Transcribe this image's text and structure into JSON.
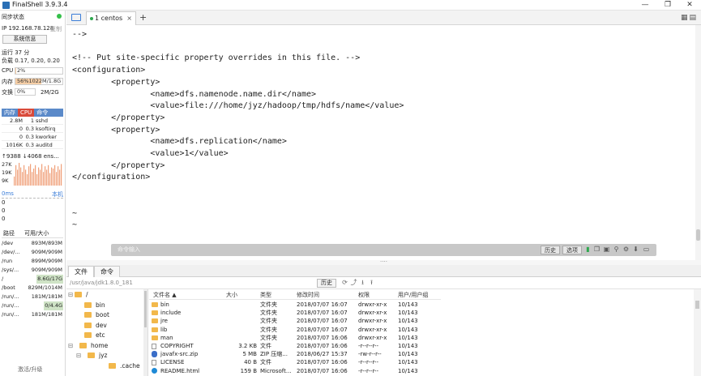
{
  "window": {
    "title": "FinalShell 3.9.3.4",
    "minimize": "—",
    "restore": "❐",
    "close": "✕"
  },
  "sidebar": {
    "sync_status": "同步状态",
    "sync_indicator_color": "#35c04a",
    "ip": "IP 192.168.78.128",
    "copy": "复制",
    "sys_info_button": "系统信息",
    "uptime": "运行 37 分",
    "load": "负载 0.17, 0.20, 0.20",
    "cpu_label": "CPU",
    "cpu_value": "2%",
    "cpu_percent": 2,
    "mem_label": "内存",
    "mem_value": "56%1022M/1.8G",
    "mem_percent": 56,
    "swap_label": "交换",
    "swap_value": "0%",
    "swap_total": "2M/2G",
    "proc_tabs": [
      "内存",
      "CPU",
      "命令"
    ],
    "processes": [
      {
        "mem": "2.8M",
        "cpu": "1",
        "cmd": "sshd"
      },
      {
        "mem": "0",
        "cpu": "0.3",
        "cmd": "ksoftirq"
      },
      {
        "mem": "0",
        "cpu": "0.3",
        "cmd": "kworker"
      },
      {
        "mem": "1016K",
        "cpu": "0.3",
        "cmd": "auditd"
      }
    ],
    "net_summary": "↑9388 ↓4068 ens...",
    "net_axis": [
      "27K",
      "19K",
      "9K"
    ],
    "latency_label": "0ms",
    "latency_host": "本机",
    "latency_values": [
      "0",
      "0",
      "0"
    ],
    "disk_header": {
      "path": "路径",
      "size": "可用/大小"
    },
    "disks": [
      {
        "path": "/dev",
        "size": "893M/893M",
        "highlight": false
      },
      {
        "path": "/dev/...",
        "size": "909M/909M",
        "highlight": false
      },
      {
        "path": "/run",
        "size": "899M/909M",
        "highlight": false
      },
      {
        "path": "/sys/...",
        "size": "909M/909M",
        "highlight": false
      },
      {
        "path": "/",
        "size": "8.6G/17G",
        "highlight": true
      },
      {
        "path": "/boot",
        "size": "829M/1014M",
        "highlight": false
      },
      {
        "path": "/run/...",
        "size": "181M/181M",
        "highlight": false
      },
      {
        "path": "/run/...",
        "size": "0/4.4G",
        "highlight": true
      },
      {
        "path": "/run/...",
        "size": "181M/181M",
        "highlight": false
      }
    ],
    "activate": "激活/升级"
  },
  "tabs": {
    "items": [
      {
        "label": "1 centos",
        "close": "×"
      }
    ],
    "add": "+"
  },
  "terminal": {
    "lines": [
      "-->",
      "",
      "<!-- Put site-specific property overrides in this file. -->",
      "<configuration>",
      "        <property>",
      "                <name>dfs.namenode.name.dir</name>",
      "                <value>file:///home/jyz/hadoop/tmp/hdfs/name</value>",
      "        </property>",
      "        <property>",
      "                <name>dfs.replication</name>",
      "                <value>1</value>",
      "        </property>",
      "</configuration>",
      "",
      "",
      "~",
      "~"
    ]
  },
  "command_bar": {
    "placeholder": "命令输入",
    "history": "历史",
    "options": "选项"
  },
  "bottom_tabs": [
    "文件",
    "命令"
  ],
  "file_browser": {
    "path": "/usr/java/jdk1.8.0_181",
    "history_button": "历史",
    "tree": [
      {
        "label": "/",
        "expander": "⊟"
      },
      {
        "label": "bin",
        "expander": ""
      },
      {
        "label": "boot",
        "expander": ""
      },
      {
        "label": "dev",
        "expander": ""
      },
      {
        "label": "etc",
        "expander": ""
      },
      {
        "label": "home",
        "expander": "⊟"
      },
      {
        "label": "jyz",
        "expander": "⊟"
      },
      {
        "label": ".cache",
        "expander": ""
      }
    ],
    "columns": {
      "name": "文件名 ▲",
      "size": "大小",
      "type": "类型",
      "modified": "修改时间",
      "perm": "权限",
      "owner": "用户/用户组"
    },
    "files": [
      {
        "name": "bin",
        "size": "",
        "type": "文件夹",
        "modified": "2018/07/07 16:07",
        "perm": "drwxr-xr-x",
        "owner": "10/143",
        "icon": "dir"
      },
      {
        "name": "include",
        "size": "",
        "type": "文件夹",
        "modified": "2018/07/07 16:07",
        "perm": "drwxr-xr-x",
        "owner": "10/143",
        "icon": "dir"
      },
      {
        "name": "jre",
        "size": "",
        "type": "文件夹",
        "modified": "2018/07/07 16:07",
        "perm": "drwxr-xr-x",
        "owner": "10/143",
        "icon": "dir"
      },
      {
        "name": "lib",
        "size": "",
        "type": "文件夹",
        "modified": "2018/07/07 16:07",
        "perm": "drwxr-xr-x",
        "owner": "10/143",
        "icon": "dir"
      },
      {
        "name": "man",
        "size": "",
        "type": "文件夹",
        "modified": "2018/07/07 16:06",
        "perm": "drwxr-xr-x",
        "owner": "10/143",
        "icon": "dir"
      },
      {
        "name": "COPYRIGHT",
        "size": "3.2 KB",
        "type": "文件",
        "modified": "2018/07/07 16:06",
        "perm": "-r--r--r--",
        "owner": "10/143",
        "icon": "file"
      },
      {
        "name": "javafx-src.zip",
        "size": "5 MB",
        "type": "ZIP 压缩...",
        "modified": "2018/06/27 15:37",
        "perm": "-rw-r--r--",
        "owner": "10/143",
        "icon": "zip"
      },
      {
        "name": "LICENSE",
        "size": "40 B",
        "type": "文件",
        "modified": "2018/07/07 16:06",
        "perm": "-r--r--r--",
        "owner": "10/143",
        "icon": "file"
      },
      {
        "name": "README.html",
        "size": "159 B",
        "type": "Microsoft...",
        "modified": "2018/07/07 16:06",
        "perm": "-r--r--r--",
        "owner": "10/143",
        "icon": "web"
      }
    ]
  },
  "colors": {
    "accent": "#3b7dd8",
    "cpu_tab": "#d94a3a",
    "proc_tab_bar": "#5b8ac9",
    "mem_fill": "#f6cfa7",
    "net_up": "#d94a3a",
    "net_down": "#2a8f3a",
    "folder": "#f2b84b"
  },
  "net_chart": {
    "heights": [
      0.4,
      0.9,
      0.7,
      1.0,
      0.8,
      0.6,
      0.9,
      0.7,
      0.5,
      0.85,
      0.95,
      0.6,
      0.75,
      0.9,
      0.5,
      0.8,
      0.7,
      0.95,
      0.6,
      0.85,
      0.7,
      0.9,
      0.55,
      0.8,
      0.75,
      0.9,
      0.6,
      0.85,
      0.7,
      0.95
    ]
  }
}
